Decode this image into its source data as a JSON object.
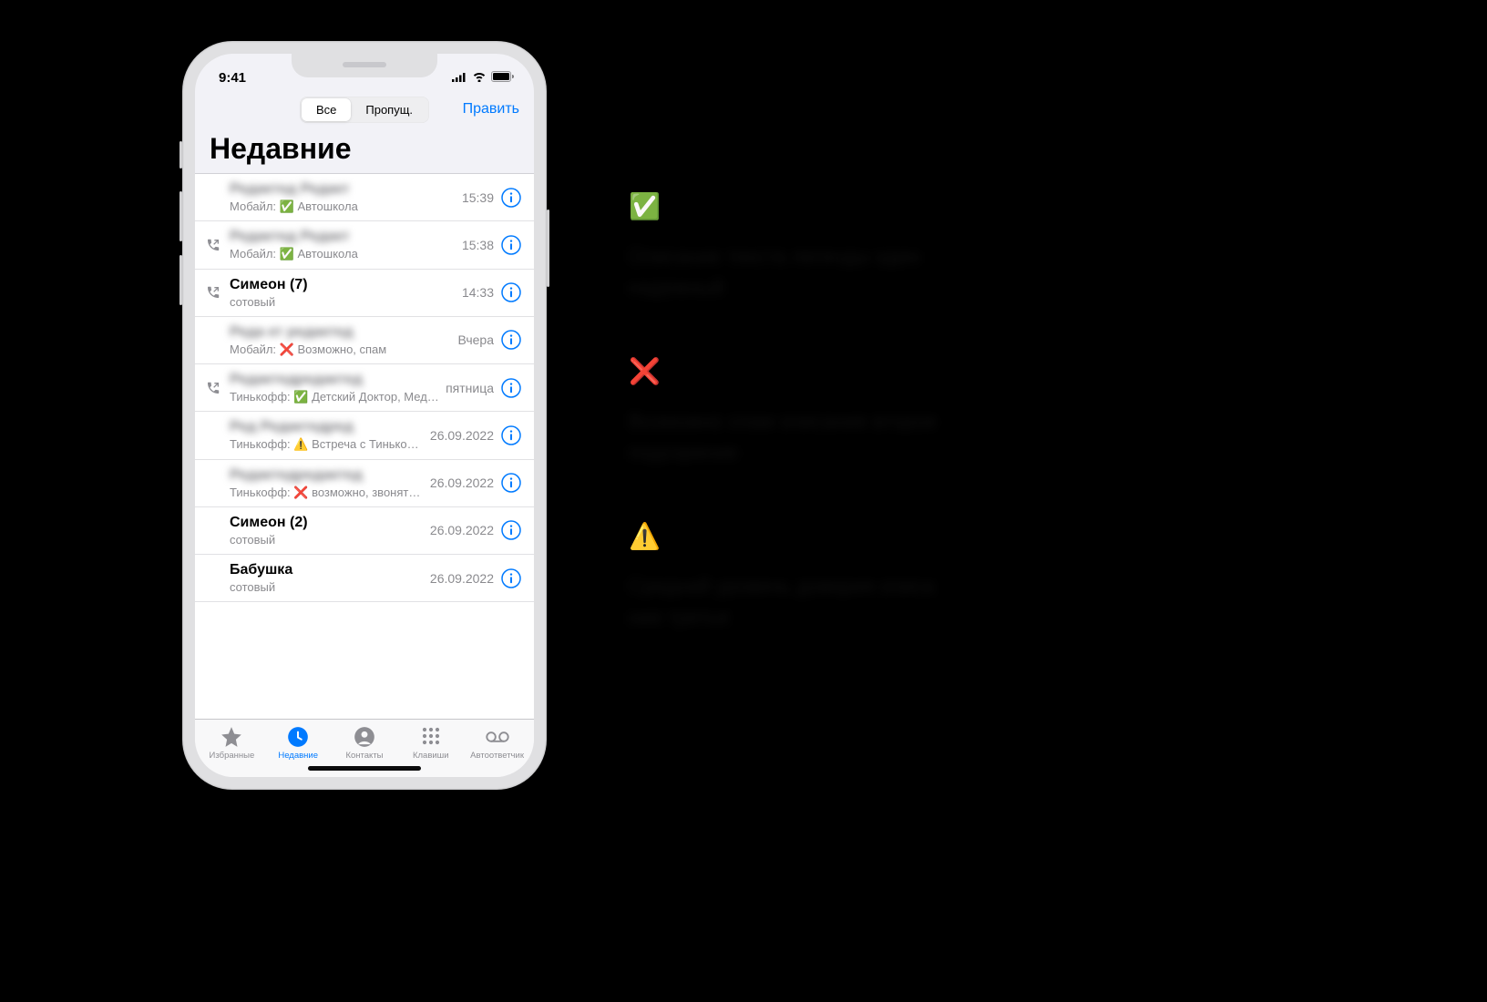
{
  "status": {
    "time": "9:41"
  },
  "nav": {
    "segments": {
      "all": "Все",
      "missed": "Пропущ."
    },
    "edit": "Править"
  },
  "title": "Недавние",
  "calls": [
    {
      "name_blurred": true,
      "name": "Редактед Редакт",
      "sub_pre": "Мобайл: ",
      "tag": "✅",
      "sub_post": " Автошкола",
      "time": "15:39",
      "outgoing": false
    },
    {
      "name_blurred": true,
      "name": "Редактед Редакт",
      "sub_pre": "Мобайл: ",
      "tag": "✅",
      "sub_post": " Автошкола",
      "time": "15:38",
      "outgoing": true
    },
    {
      "name_blurred": false,
      "name": "Симеон (7)",
      "sub_pre": "сотовый",
      "tag": "",
      "sub_post": "",
      "time": "14:33",
      "outgoing": true
    },
    {
      "name_blurred": true,
      "name": "Реда кт редактед",
      "sub_pre": "Мобайл: ",
      "tag": "❌",
      "sub_post": " Возможно, спам",
      "time": "Вчера",
      "outgoing": false
    },
    {
      "name_blurred": true,
      "name": "Редактедредактед",
      "sub_pre": "Тинькофф: ",
      "tag": "✅",
      "sub_post": " Детский Доктор, Мед…",
      "time": "пятница",
      "outgoing": true
    },
    {
      "name_blurred": true,
      "name": "Ред Редактедред",
      "sub_pre": "Тинькофф: ",
      "tag": "⚠️",
      "sub_post": " Встреча с Тинько…",
      "time": "26.09.2022",
      "outgoing": false
    },
    {
      "name_blurred": true,
      "name": "Редактедредактед",
      "sub_pre": "Тинькофф: ",
      "tag": "❌",
      "sub_post": " возможно, звонят…",
      "time": "26.09.2022",
      "outgoing": false
    },
    {
      "name_blurred": false,
      "name": "Симеон (2)",
      "sub_pre": "сотовый",
      "tag": "",
      "sub_post": "",
      "time": "26.09.2022",
      "outgoing": false
    },
    {
      "name_blurred": false,
      "name": "Бабушка",
      "sub_pre": "сотовый",
      "tag": "",
      "sub_post": "",
      "time": "26.09.2022",
      "outgoing": false
    }
  ],
  "tabs": {
    "favorites": "Избранные",
    "recents": "Недавние",
    "contacts": "Контакты",
    "keypad": "Клавиши",
    "voicemail": "Автоответчик"
  },
  "legend": [
    {
      "emoji": "✅",
      "line1": "Описание текста легенды один",
      "line2": "надежный"
    },
    {
      "emoji": "❌",
      "line1": "Возможно спам описание второе",
      "line2": "подозрение"
    },
    {
      "emoji": "⚠️",
      "line1": "Средний уровень доверия описа",
      "line2": "ние третье"
    }
  ]
}
